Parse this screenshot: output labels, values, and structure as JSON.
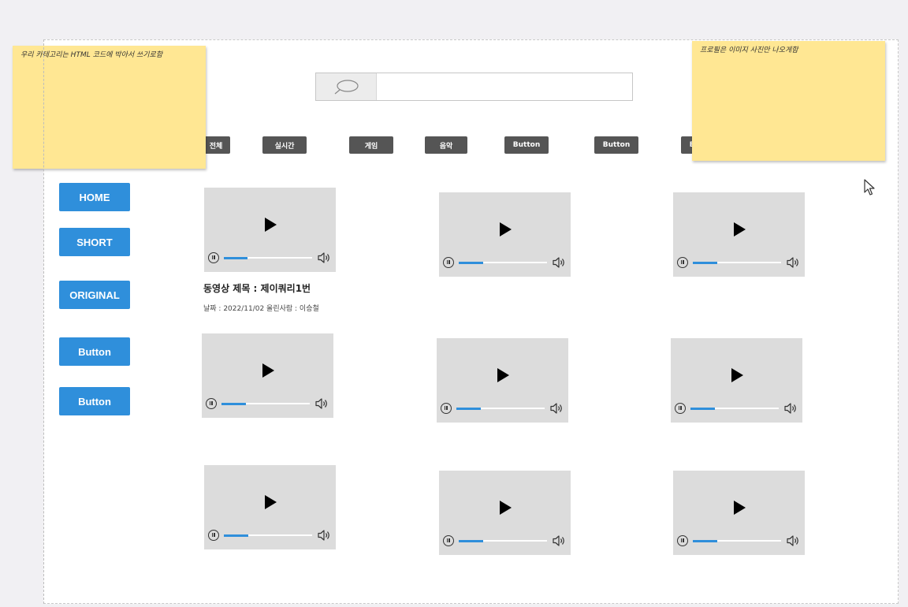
{
  "search": {
    "placeholder": ""
  },
  "categories": [
    {
      "label": "전체"
    },
    {
      "label": "실시간"
    },
    {
      "label": "게임"
    },
    {
      "label": "음악"
    },
    {
      "label": "Button"
    },
    {
      "label": "Button"
    },
    {
      "label": "Button"
    }
  ],
  "nav": [
    {
      "label": "HOME"
    },
    {
      "label": "SHORT"
    },
    {
      "label": "ORIGINAL"
    },
    {
      "label": "Button"
    },
    {
      "label": "Button"
    }
  ],
  "videos": [
    {
      "progress": 0.27
    },
    {
      "progress": 0.28
    },
    {
      "progress": 0.28
    },
    {
      "progress": 0.28
    },
    {
      "progress": 0.28
    },
    {
      "progress": 0.28
    },
    {
      "progress": 0.28
    },
    {
      "progress": 0.28
    },
    {
      "progress": 0.28
    }
  ],
  "featured": {
    "title": "동영상 제목 : 제이쿼리1번",
    "meta": "날짜 : 2022/11/02  올린사람 : 이승철"
  },
  "notes": {
    "left": "우리 카테고리는 HTML 코드에 박아서 쓰기로함",
    "right": "프로필은 이미지 사진만 나오게함"
  },
  "colors": {
    "accent": "#2f8fdb",
    "category_bg": "#555555",
    "sticky": "#ffe793",
    "video_bg": "#dcdcdc"
  }
}
